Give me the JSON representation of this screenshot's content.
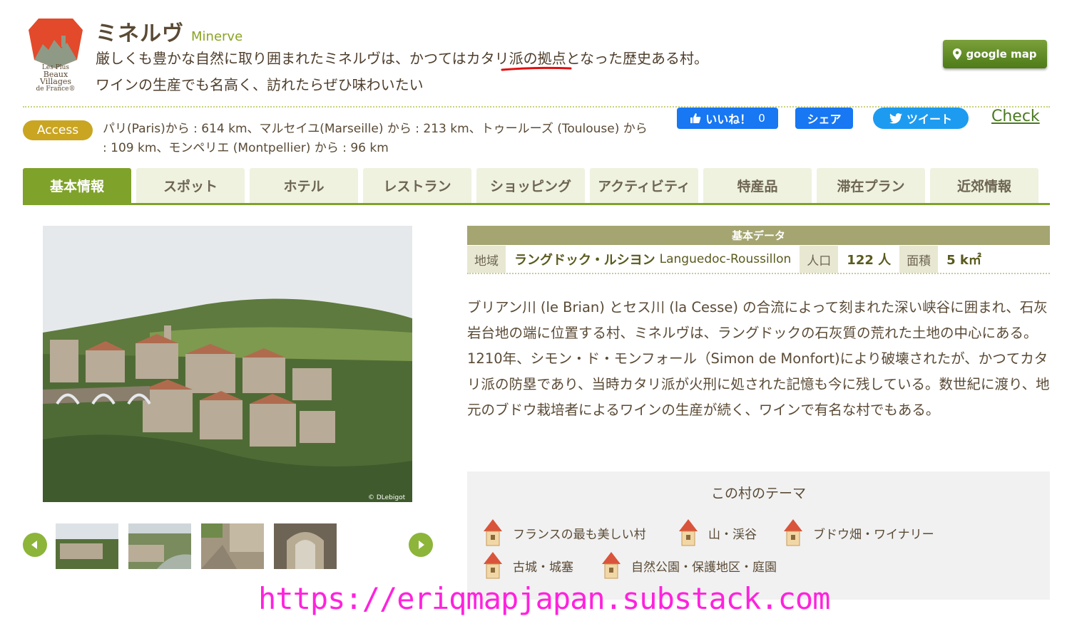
{
  "header": {
    "logo_text_small": "Les Plus",
    "logo_text_big": "Beaux Villages",
    "logo_text_sub": "de France®",
    "title_jp": "ミネルヴ",
    "title_en": "Minerve",
    "lead_line1": "厳しくも豊かな自然に取り囲まれたミネルヴは、かつてはカタリ派の拠点となった歴史ある村。",
    "lead_line2": "ワインの生産でも名高く、訪れたらぜひ味わいたい",
    "gmap_label": "google map"
  },
  "access": {
    "badge": "Access",
    "text": "パリ(Paris)から : 614 km、マルセイユ(Marseille) から : 213 km、トゥールーズ (Toulouse) から : 109 km、モンペリエ (Montpellier) から : 96 km"
  },
  "social": {
    "like_label": "いいね！",
    "like_count": "0",
    "share_label": "シェア",
    "tweet_label": "ツイート",
    "check_label": "Check"
  },
  "tabs": [
    {
      "label": "基本情報",
      "active": true
    },
    {
      "label": "スポット"
    },
    {
      "label": "ホテル"
    },
    {
      "label": "レストラン"
    },
    {
      "label": "ショッピング"
    },
    {
      "label": "アクティビティ"
    },
    {
      "label": "特産品"
    },
    {
      "label": "滞在プラン"
    },
    {
      "label": "近郊情報"
    }
  ],
  "photo": {
    "credit": "© DLebigot"
  },
  "basic_data": {
    "heading": "基本データ",
    "region_label": "地域",
    "region_value_jp": "ラングドック・ルシヨン",
    "region_value_en": "Languedoc-Roussillon",
    "population_label": "人口",
    "population_value": "122 人",
    "area_label": "面積",
    "area_value": "5 k㎡"
  },
  "description": "ブリアン川 (le Brian) とセス川 (la Cesse) の合流によって刻まれた深い峡谷に囲まれ、石灰岩台地の端に位置する村、ミネルヴは、ラングドックの石灰質の荒れた土地の中心にある。1210年、シモン・ド・モンフォール（Simon de Monfort)により破壊されたが、かつてカタリ派の防塁であり、当時カタリ派が火刑に処された記憶も今に残している。数世紀に渡り、地元のブドウ栽培者によるワインの生産が続く、ワインで有名な村でもある。",
  "themes": {
    "title": "この村のテーマ",
    "items": [
      "フランスの最も美しい村",
      "山・渓谷",
      "ブドウ畑・ワイナリー",
      "古城・城塞",
      "自然公園・保護地区・庭園"
    ]
  },
  "watermark": "https://eriqmapjapan.substack.com",
  "colors": {
    "accent_green": "#7fa22a",
    "access_gold": "#c9a521",
    "facebook_blue": "#1877f2",
    "twitter_blue": "#1d9bf0",
    "watermark_magenta": "#ff22dd"
  }
}
